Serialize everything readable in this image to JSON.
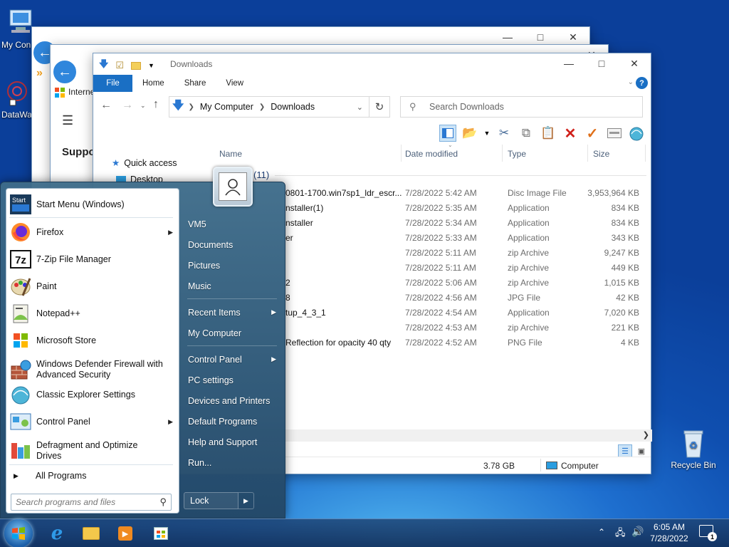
{
  "desktop": {
    "icons": [
      {
        "label": "My Con"
      },
      {
        "label": "DataWa"
      },
      {
        "label": "Recycle Bin"
      }
    ]
  },
  "back_windows": {
    "ie_title": "Interne",
    "support_text": "Suppo"
  },
  "explorer": {
    "title": "Downloads",
    "tabs": [
      "File",
      "Home",
      "Share",
      "View"
    ],
    "breadcrumb": [
      "My Computer",
      "Downloads"
    ],
    "search_placeholder": "Search Downloads",
    "nav_pane": [
      {
        "label": "Quick access"
      },
      {
        "label": "Desktop"
      }
    ],
    "columns": {
      "name": "Name",
      "date": "Date modified",
      "type": "Type",
      "size": "Size"
    },
    "group_count": "(11)",
    "rows": [
      {
        "name": "0801-1700.win7sp1_ldr_escr...",
        "date": "7/28/2022 5:42 AM",
        "type": "Disc Image File",
        "size": "3,953,964 KB"
      },
      {
        "name": "nstaller(1)",
        "date": "7/28/2022 5:35 AM",
        "type": "Application",
        "size": "834 KB"
      },
      {
        "name": "nstaller",
        "date": "7/28/2022 5:34 AM",
        "type": "Application",
        "size": "834 KB"
      },
      {
        "name": "er",
        "date": "7/28/2022 5:33 AM",
        "type": "Application",
        "size": "343 KB"
      },
      {
        "name": "",
        "date": "7/28/2022 5:11 AM",
        "type": "zip Archive",
        "size": "9,247 KB"
      },
      {
        "name": "",
        "date": "7/28/2022 5:11 AM",
        "type": "zip Archive",
        "size": "449 KB"
      },
      {
        "name": "2",
        "date": "7/28/2022 5:06 AM",
        "type": "zip Archive",
        "size": "1,015 KB"
      },
      {
        "name": "8",
        "date": "7/28/2022 4:56 AM",
        "type": "JPG File",
        "size": "42 KB"
      },
      {
        "name": "tup_4_3_1",
        "date": "7/28/2022 4:54 AM",
        "type": "Application",
        "size": "7,020 KB"
      },
      {
        "name": "",
        "date": "7/28/2022 4:53 AM",
        "type": "zip Archive",
        "size": "221 KB"
      },
      {
        "name": "Reflection for opacity 40 qty",
        "date": "7/28/2022 4:52 AM",
        "type": "PNG File",
        "size": "4 KB"
      }
    ],
    "status_size": "3.78 GB",
    "status_location": "Computer"
  },
  "start_menu": {
    "programs": [
      {
        "label": "Start Menu (Windows)",
        "icon": "start-menu-icon",
        "arrow": false
      },
      {
        "label": "Firefox",
        "icon": "firefox-icon",
        "arrow": true
      },
      {
        "label": "7-Zip File Manager",
        "icon": "7zip-icon",
        "arrow": false
      },
      {
        "label": "Paint",
        "icon": "paint-icon",
        "arrow": false
      },
      {
        "label": "Notepad++",
        "icon": "notepadpp-icon",
        "arrow": false
      },
      {
        "label": "Microsoft Store",
        "icon": "store-icon",
        "arrow": false
      },
      {
        "label": "Windows Defender Firewall with Advanced Security",
        "icon": "firewall-icon",
        "arrow": false
      },
      {
        "label": "Classic Explorer Settings",
        "icon": "shell-icon",
        "arrow": false
      },
      {
        "label": "Control Panel",
        "icon": "control-panel-icon",
        "arrow": true
      },
      {
        "label": "Defragment and Optimize Drives",
        "icon": "defrag-icon",
        "arrow": false
      }
    ],
    "all_programs": "All Programs",
    "search_placeholder": "Search programs and files",
    "right_items": [
      {
        "label": "VM5",
        "arrow": false
      },
      {
        "label": "Documents",
        "arrow": false
      },
      {
        "label": "Pictures",
        "arrow": false
      },
      {
        "label": "Music",
        "arrow": false
      },
      {
        "label": "Recent Items",
        "arrow": true
      },
      {
        "label": "My Computer",
        "arrow": false
      },
      {
        "label": "Control Panel",
        "arrow": true
      },
      {
        "label": "PC settings",
        "arrow": false
      },
      {
        "label": "Devices and Printers",
        "arrow": false
      },
      {
        "label": "Default Programs",
        "arrow": false
      },
      {
        "label": "Help and Support",
        "arrow": false
      },
      {
        "label": "Run...",
        "arrow": false
      }
    ],
    "lock_label": "Lock"
  },
  "taskbar": {
    "time": "6:05 AM",
    "date": "7/28/2022",
    "notification_count": "1"
  },
  "colors": {
    "accent": "#1a6fc4",
    "start_menu": "#2f5a7e",
    "taskbar": "#17375f"
  }
}
